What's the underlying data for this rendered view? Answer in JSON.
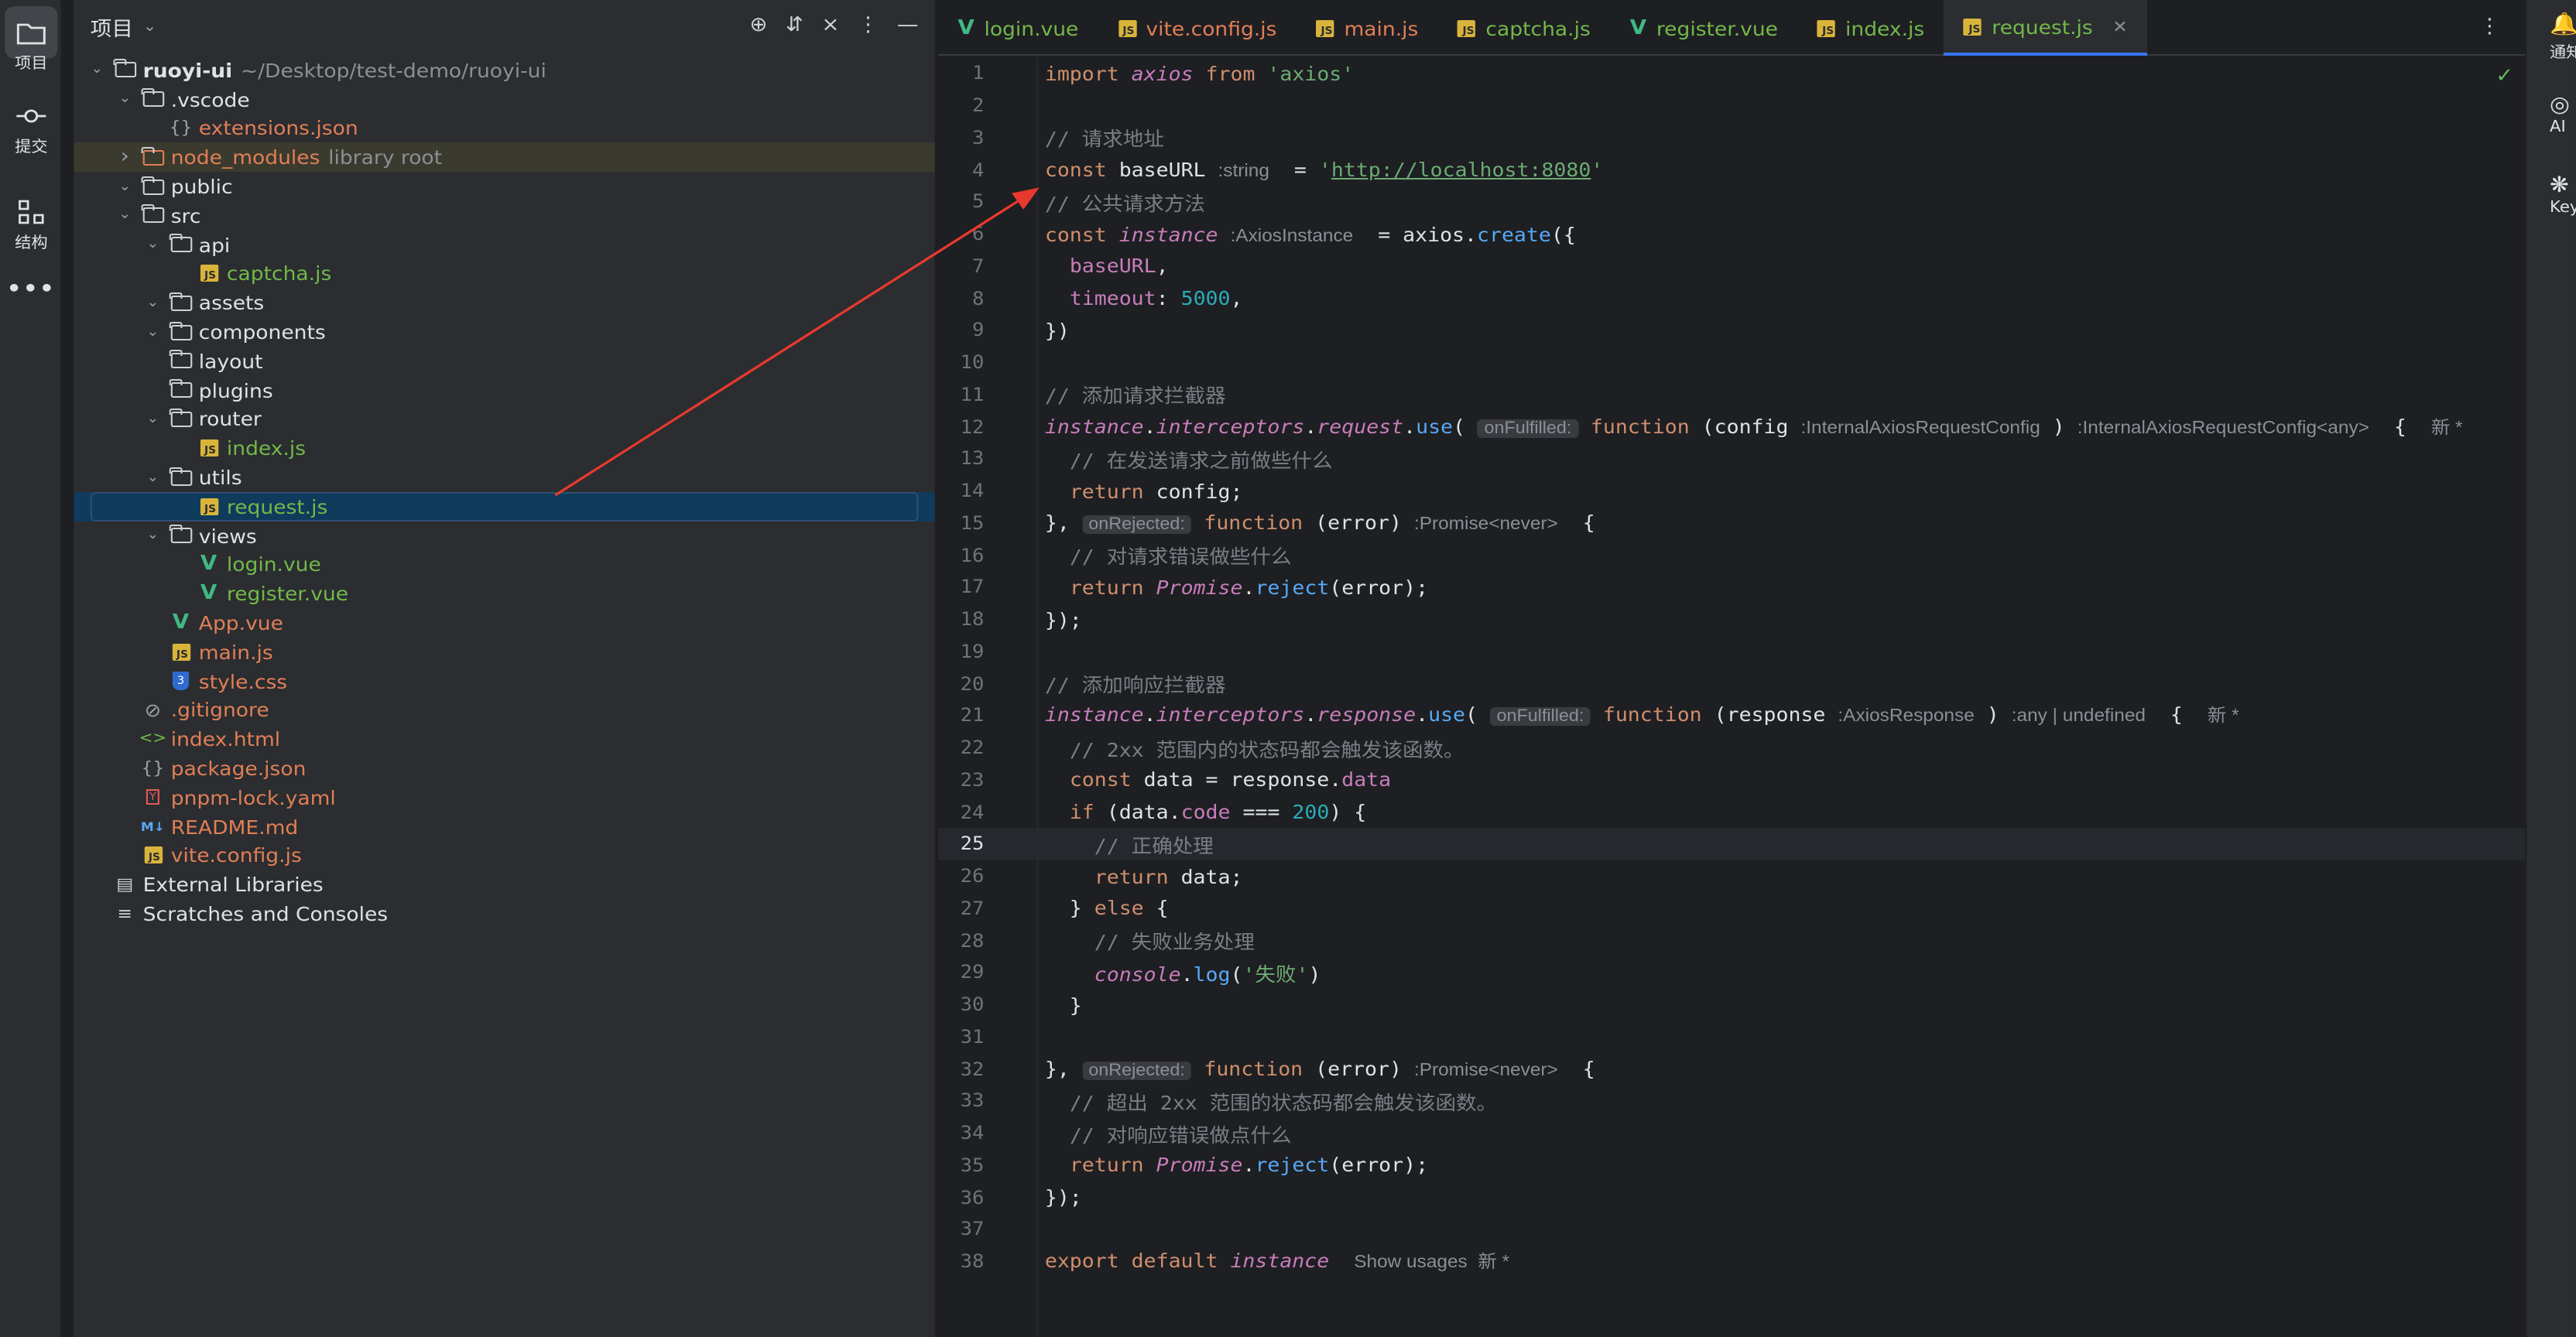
{
  "activity_bar": [
    {
      "label": "项目",
      "icon": "folder-icon"
    },
    {
      "label": "提交",
      "icon": "commit-icon"
    },
    {
      "label": "结构",
      "icon": "structure-icon"
    },
    {
      "label": "...",
      "icon": "more-icon"
    }
  ],
  "project_panel": {
    "title": "项目",
    "tree": [
      {
        "depth": 0,
        "arrow": "down",
        "icon": "folder",
        "name": "ruoyi-ui",
        "extra": "~/Desktop/test-demo/ruoyi-ui",
        "bold": true,
        "color": "default"
      },
      {
        "depth": 1,
        "arrow": "down",
        "icon": "folder",
        "name": ".vscode",
        "color": "default"
      },
      {
        "depth": 2,
        "arrow": "",
        "icon": "json",
        "name": "extensions.json",
        "color": "orange"
      },
      {
        "depth": 1,
        "arrow": "right",
        "icon": "folder-orange",
        "name": "node_modules",
        "extra": "library root",
        "color": "orange",
        "excluded": true
      },
      {
        "depth": 1,
        "arrow": "down",
        "icon": "folder",
        "name": "public",
        "color": "default"
      },
      {
        "depth": 1,
        "arrow": "down",
        "icon": "folder",
        "name": "src",
        "color": "default"
      },
      {
        "depth": 2,
        "arrow": "down",
        "icon": "folder",
        "name": "api",
        "color": "default"
      },
      {
        "depth": 3,
        "arrow": "",
        "icon": "js",
        "name": "captcha.js",
        "color": "green"
      },
      {
        "depth": 2,
        "arrow": "down",
        "icon": "folder",
        "name": "assets",
        "color": "default"
      },
      {
        "depth": 2,
        "arrow": "down",
        "icon": "folder",
        "name": "components",
        "color": "default"
      },
      {
        "depth": 2,
        "arrow": "",
        "icon": "folder",
        "name": "layout",
        "color": "default"
      },
      {
        "depth": 2,
        "arrow": "",
        "icon": "folder",
        "name": "plugins",
        "color": "default"
      },
      {
        "depth": 2,
        "arrow": "down",
        "icon": "folder",
        "name": "router",
        "color": "default"
      },
      {
        "depth": 3,
        "arrow": "",
        "icon": "js",
        "name": "index.js",
        "color": "green"
      },
      {
        "depth": 2,
        "arrow": "down",
        "icon": "folder",
        "name": "utils",
        "color": "default"
      },
      {
        "depth": 3,
        "arrow": "",
        "icon": "js",
        "name": "request.js",
        "color": "green",
        "selected": true
      },
      {
        "depth": 2,
        "arrow": "down",
        "icon": "folder",
        "name": "views",
        "color": "default"
      },
      {
        "depth": 3,
        "arrow": "",
        "icon": "vue",
        "name": "login.vue",
        "color": "green"
      },
      {
        "depth": 3,
        "arrow": "",
        "icon": "vue",
        "name": "register.vue",
        "color": "green"
      },
      {
        "depth": 2,
        "arrow": "",
        "icon": "vue",
        "name": "App.vue",
        "color": "orange"
      },
      {
        "depth": 2,
        "arrow": "",
        "icon": "js",
        "name": "main.js",
        "color": "orange"
      },
      {
        "depth": 2,
        "arrow": "",
        "icon": "css",
        "name": "style.css",
        "color": "orange"
      },
      {
        "depth": 1,
        "arrow": "",
        "icon": "ignore",
        "name": ".gitignore",
        "color": "orange"
      },
      {
        "depth": 1,
        "arrow": "",
        "icon": "html",
        "name": "index.html",
        "color": "orange"
      },
      {
        "depth": 1,
        "arrow": "",
        "icon": "json",
        "name": "package.json",
        "color": "orange"
      },
      {
        "depth": 1,
        "arrow": "",
        "icon": "yaml",
        "name": "pnpm-lock.yaml",
        "color": "orange"
      },
      {
        "depth": 1,
        "arrow": "",
        "icon": "md",
        "name": "README.md",
        "color": "orange"
      },
      {
        "depth": 1,
        "arrow": "",
        "icon": "js",
        "name": "vite.config.js",
        "color": "orange"
      },
      {
        "depth": 0,
        "arrow": "",
        "icon": "library",
        "name": "External Libraries",
        "color": "default"
      },
      {
        "depth": 0,
        "arrow": "",
        "icon": "scratch",
        "name": "Scratches and Consoles",
        "color": "default"
      }
    ]
  },
  "tabs": [
    {
      "name": "login.vue",
      "icon": "vue",
      "color": "green",
      "active": false
    },
    {
      "name": "vite.config.js",
      "icon": "js",
      "color": "orange",
      "active": false
    },
    {
      "name": "main.js",
      "icon": "js",
      "color": "orange",
      "active": false
    },
    {
      "name": "captcha.js",
      "icon": "js",
      "color": "green",
      "active": false
    },
    {
      "name": "register.vue",
      "icon": "vue",
      "color": "green",
      "active": false
    },
    {
      "name": "index.js",
      "icon": "js",
      "color": "green",
      "active": false
    },
    {
      "name": "request.js",
      "icon": "js",
      "color": "green",
      "active": true
    }
  ],
  "code_lines": [
    {
      "n": "1",
      "html": "<span class='kw'>import</span> <span class='ital-id'>axios</span> <span class='kw'>from</span> <span class='str'>'axios'</span>"
    },
    {
      "n": "2",
      "html": ""
    },
    {
      "n": "3",
      "html": "<span class='cm'>// 请求地址</span>"
    },
    {
      "n": "4",
      "html": "<span class='kw'>const</span> baseURL <span class='hint'>:string</span>  = <span class='str'>'</span><span class='url'>http://localhost:8080</span><span class='str'>'</span>"
    },
    {
      "n": "5",
      "html": "<span class='cm'>// 公共请求方法</span>"
    },
    {
      "n": "6",
      "html": "<span class='kw'>const</span> <span class='ital-id'>instance</span> <span class='hint'>:AxiosInstance</span>  = axios.<span class='fn'>create</span>({"
    },
    {
      "n": "7",
      "html": "  <span class='prop'>baseURL</span>,"
    },
    {
      "n": "8",
      "html": "  <span class='prop'>timeout</span>: <span class='num-l'>5000</span>,"
    },
    {
      "n": "9",
      "html": "})"
    },
    {
      "n": "10",
      "html": ""
    },
    {
      "n": "11",
      "html": "<span class='cm'>// 添加请求拦截器</span>"
    },
    {
      "n": "12",
      "html": "<span class='ital-id'>instance</span>.<span class='prop it'>interceptors</span>.<span class='prop it'>request</span>.<span class='fn'>use</span>( <span class='hintbox'>onFulfilled:</span> <span class='kw'>function</span> (config <span class='hint'>:InternalAxiosRequestConfig</span> ) <span class='hint'>:InternalAxiosRequestConfig&lt;any&gt;</span>  {  <span class='hint'>新 *</span>"
    },
    {
      "n": "13",
      "html": "  <span class='cm'>// 在发送请求之前做些什么</span>"
    },
    {
      "n": "14",
      "html": "  <span class='kw'>return</span> config;"
    },
    {
      "n": "15",
      "html": "}, <span class='hintbox'>onRejected:</span> <span class='kw'>function</span> (error) <span class='hint'>:Promise&lt;never&gt;</span>  {"
    },
    {
      "n": "16",
      "html": "  <span class='cm'>// 对请求错误做些什么</span>"
    },
    {
      "n": "17",
      "html": "  <span class='kw'>return</span> <span class='ital-id'>Promise</span>.<span class='fn'>reject</span>(error);"
    },
    {
      "n": "18",
      "html": "});"
    },
    {
      "n": "19",
      "html": ""
    },
    {
      "n": "20",
      "html": "<span class='cm'>// 添加响应拦截器</span>"
    },
    {
      "n": "21",
      "html": "<span class='ital-id'>instance</span>.<span class='prop it'>interceptors</span>.<span class='prop it'>response</span>.<span class='fn'>use</span>( <span class='hintbox'>onFulfilled:</span> <span class='kw'>function</span> (response <span class='hint'>:AxiosResponse</span> ) <span class='hint'>:any | undefined</span>  {  <span class='hint'>新 *</span>"
    },
    {
      "n": "22",
      "html": "  <span class='cm'>// 2xx 范围内的状态码都会触发该函数。</span>"
    },
    {
      "n": "23",
      "html": "  <span class='kw'>const</span> data = response.<span class='prop'>data</span>"
    },
    {
      "n": "24",
      "html": "  <span class='kw'>if</span> (data.<span class='prop'>code</span> === <span class='num-l'>200</span>) {"
    },
    {
      "n": "25",
      "html": "    <span class='cm'>// 正确处理</span>",
      "current": true
    },
    {
      "n": "26",
      "html": "    <span class='kw'>return</span> data;"
    },
    {
      "n": "27",
      "html": "  } <span class='kw'>else</span> {"
    },
    {
      "n": "28",
      "html": "    <span class='cm'>// 失败业务处理</span>"
    },
    {
      "n": "29",
      "html": "    <span class='ital-id'>console</span>.<span class='fn'>log</span>(<span class='str'>'失败'</span>)"
    },
    {
      "n": "30",
      "html": "  }"
    },
    {
      "n": "31",
      "html": ""
    },
    {
      "n": "32",
      "html": "}, <span class='hintbox'>onRejected:</span> <span class='kw'>function</span> (error) <span class='hint'>:Promise&lt;never&gt;</span>  {"
    },
    {
      "n": "33",
      "html": "  <span class='cm'>// 超出 2xx 范围的状态码都会触发该函数。</span>"
    },
    {
      "n": "34",
      "html": "  <span class='cm'>// 对响应错误做点什么</span>"
    },
    {
      "n": "35",
      "html": "  <span class='kw'>return</span> <span class='ital-id'>Promise</span>.<span class='fn'>reject</span>(error);"
    },
    {
      "n": "36",
      "html": "});"
    },
    {
      "n": "37",
      "html": ""
    },
    {
      "n": "38",
      "html": "<span class='kw'>export default</span> <span class='ital-id'>instance</span>  <span class='hint'>Show usages  新 *</span>"
    }
  ],
  "right_bar": [
    {
      "label": "通知",
      "icon": "bell-icon"
    },
    {
      "label": "AI",
      "icon": "ai-icon"
    },
    {
      "label": "Key P",
      "icon": "key-icon"
    }
  ],
  "colors": {
    "arrow": "#e8392e",
    "selection": "#0f3b5c",
    "accent": "#3574f0"
  }
}
